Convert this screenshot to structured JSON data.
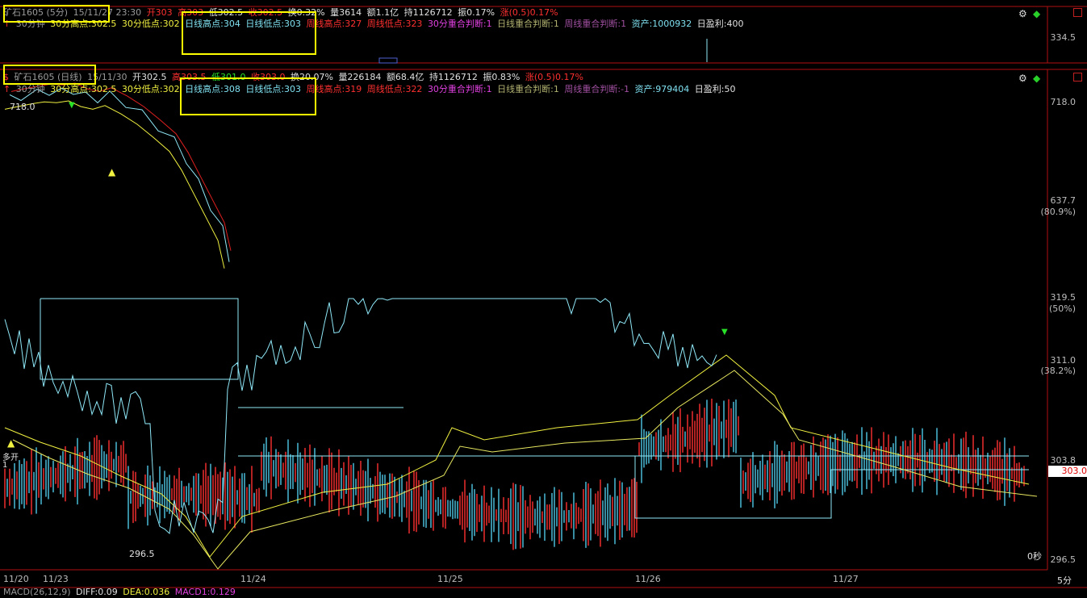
{
  "top_panel": {
    "title": "矿石1605 (5分)",
    "datetime": "15/11/27 23:30",
    "open": "开303",
    "high": "高303",
    "low": "低302.5",
    "low2": "收302.5",
    "change": "换0.32%",
    "volume": "量3614",
    "amount": "额1.1亿",
    "hold": "持1126712",
    "amp": "振0.17%",
    "rise": "涨(0.5)0.17%",
    "ind": {
      "label": "30分钟",
      "hi30": "30分高点:302.5",
      "lo30": "30分低点:302",
      "dhi": "日线高点:304",
      "dlo": "日线低点:303",
      "whi": "周线高点:327",
      "wlo": "周线低点:323",
      "ov30": "30分重合判断:1",
      "ovd": "日线重合判断:1",
      "ovw": "周线重合判断:1",
      "asset": "资产:1000932",
      "pnl": "日盈利:400"
    },
    "right_axis": "334.5"
  },
  "main_panel": {
    "title": "矿石1605 (日线)",
    "datetime": "15/11/30",
    "open": "开302.5",
    "high": "高303.5",
    "low": "低301.0",
    "close": "收303.0",
    "change": "换20.07%",
    "volume": "量226184",
    "amount": "额68.4亿",
    "hold": "持1126712",
    "amp": "振0.83%",
    "rise": "涨(0.5)0.17%",
    "ind": {
      "label": "30分钟",
      "hi30": "30分高点:302.5",
      "lo30": "30分低点:302",
      "dhi": "日线高点:308",
      "dlo": "日线低点:303",
      "whi": "周线高点:319",
      "wlo": "周线低点:322",
      "ov30": "30分重合判断:1",
      "ovd": "日线重合判断:1",
      "ovw": "周线重合判断:-1",
      "asset": "资产:979404",
      "pnl": "日盈利:50"
    },
    "axis": {
      "p718": "718.0",
      "p637": "637.7",
      "pct809": "(80.9%)",
      "p319": "319.5",
      "pct50": "(50%)",
      "p311": "311.0",
      "pct382": "(38.2%)",
      "p303_8": "303.8",
      "p303_0": "303.0",
      "p296": "296.5"
    },
    "hi_label": "718.0",
    "lo_label": "296.5",
    "sec_label": "0秒",
    "period": "5分",
    "signals": {
      "open_long": "多开",
      "one": "1"
    }
  },
  "dates": [
    "11/20",
    "11/23",
    "11/24",
    "11/25",
    "11/26",
    "11/27"
  ],
  "macd": {
    "label": "MACD(26,12,9)",
    "diff": "DIFF:0.09",
    "dea": "DEA:0.036",
    "macd": "MACD1:0.129"
  },
  "colors": {
    "bg": "#000000",
    "up": "#ff3030",
    "down": "#4fc8e8",
    "yellow": "#f0f040",
    "cyan_line": "#8fe8f8",
    "red_line": "#e02020",
    "highlight": "#ffff00"
  },
  "chart_data": {
    "type": "line",
    "title": "矿石1605",
    "xlabel": "",
    "ylabel": "",
    "x": [
      "11/20",
      "11/23",
      "11/24",
      "11/25",
      "11/26",
      "11/27"
    ],
    "series": [
      {
        "name": "",
        "values": [
          300,
          305,
          298,
          303,
          307,
          303
        ]
      },
      {
        "name": "",
        "values": [
          303,
          303,
          311,
          311,
          303,
          303.8
        ]
      },
      {
        "name": "",
        "values": [
          301,
          304,
          302,
          304,
          308,
          302.5
        ]
      }
    ],
    "ylim": [
      296.5,
      319.5
    ],
    "grid": false,
    "legend": "none"
  }
}
